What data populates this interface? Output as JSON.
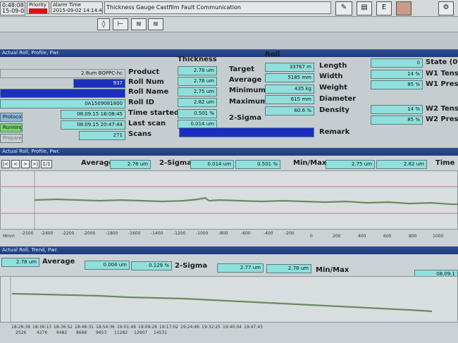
{
  "topbar": {
    "time1": "0:48:08",
    "date1": "15-09-08",
    "priority_label": "Priority",
    "alarm_time_label": "Alarm Time",
    "alarm_time_value": "2015-09-02 14:14:46",
    "alarm_message": "Thickness Gauge Castfilm Fault Communication"
  },
  "colors": {
    "field": "#8fe0dc",
    "dark_blue": "#1b2fbf",
    "alarm_red": "#e01010",
    "header_blue": "#2d4f95",
    "trace": "#6b8a5c"
  },
  "top_panel": {
    "title": "Actual Roll, Profile, Pwr.",
    "left_values": [
      "2.8um BOPPC-hc",
      "937",
      "",
      "0A1509081800",
      "08.09.15 18:08:45",
      "08.09.15 20:47:44",
      "271"
    ],
    "left_labels": [
      "Product",
      "Roll Num",
      "Roll Name",
      "Roll ID",
      "Time started",
      "Last scan",
      "Scans"
    ],
    "status_buttons": [
      "Protocol",
      "Running",
      "Prepare"
    ],
    "thickness": {
      "header": "Thickness",
      "values": [
        "2.78 um",
        "2.78 um",
        "2.75 um",
        "2.82 um",
        "0.501 %",
        "0.014 um"
      ],
      "labels": [
        "Target",
        "Average",
        "Minimum",
        "Maximum",
        "2-Sigma"
      ]
    },
    "roll": {
      "header": "Roll",
      "values": [
        "33767 m",
        "5185 mm",
        "435 kg",
        "615 mm",
        "60.6 %"
      ],
      "labels": [
        "Length",
        "Width",
        "Weight",
        "Diameter",
        "Density"
      ]
    },
    "remark_label": "Remark",
    "right": {
      "values": [
        "0",
        "14 %",
        "85 %",
        "14 %",
        "85 %"
      ],
      "labels": [
        "State (0=",
        "W1 Tens.",
        "W1 Press",
        "W2 Tens.",
        "W2 Press"
      ]
    }
  },
  "profile_panel": {
    "title": "Actual Roll, Profile, Pwr.",
    "nav": [
      "|<",
      "<",
      ">",
      ">|",
      "1/1"
    ],
    "average_label": "Average",
    "average_value": "2.78 um",
    "sigma_label": "2-Sigma",
    "sigma_value1": "0.014 um",
    "sigma_value2": "0.501 %",
    "minmax_label": "Min/Max",
    "min_value": "2.75 um",
    "max_value": "2.82 um",
    "time_label": "Time",
    "x_axis_name": "Mmm",
    "x_ticks": [
      "-2500",
      "-2400",
      "-2200",
      "-2000",
      "-1800",
      "-1600",
      "-1400",
      "-1200",
      "-1000",
      "-800",
      "-600",
      "-400",
      "-200",
      "0",
      "200",
      "400",
      "600",
      "800",
      "1000"
    ]
  },
  "trend_panel": {
    "title": "Actual Roll, Trend, Pwr.",
    "average_value": "2.78 um",
    "average_label": "Average",
    "sigma_value1": "0.004 um",
    "sigma_value2": "0.129 %",
    "sigma_label": "2-Sigma",
    "min_value": "2.77 um",
    "max_value": "2.78 um",
    "minmax_label": "Min/Max",
    "right_value": "08.09.1",
    "x_ticks_time": [
      "18:28:38",
      "18:38:13",
      "18:36:52",
      "18:46:31",
      "18:54:36",
      "19:01:49",
      "19:09:28",
      "19:17:02",
      "19:24:46",
      "19:32:25",
      "19:40:04",
      "19:47:43"
    ],
    "x_ticks_count": [
      "2526",
      "4276",
      "6482",
      "8688",
      "9653",
      "11282",
      "12907",
      "14531"
    ]
  }
}
